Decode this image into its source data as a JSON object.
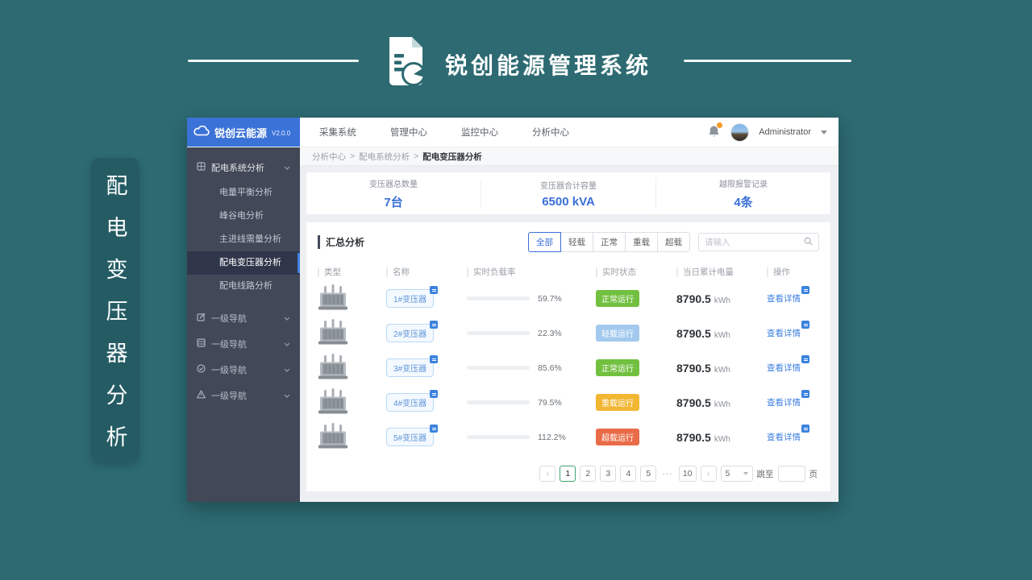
{
  "banner": {
    "title": "锐创能源管理系统"
  },
  "side_label": {
    "text": "配电变压器分析"
  },
  "dashboard": {
    "logo": {
      "name": "锐创云能源",
      "version": "V2.0.0"
    },
    "topnav": {
      "items": [
        "采集系统",
        "管理中心",
        "监控中心",
        "分析中心"
      ]
    },
    "user": {
      "name": "Administrator"
    },
    "sidebar": {
      "group_label": "配电系统分析",
      "children": [
        "电量平衡分析",
        "峰谷电分析",
        "主进线需量分析",
        "配电变压器分析",
        "配电线路分析"
      ],
      "extras": [
        "一级导航",
        "一级导航",
        "一级导航",
        "一级导航"
      ]
    },
    "breadcrumb": {
      "items": [
        "分析中心",
        "配电系统分析",
        "配电变压器分析"
      ],
      "separator": ">"
    },
    "stats": [
      {
        "label": "变压器总数量",
        "value": "7台"
      },
      {
        "label": "变压器合计容量",
        "value": "6500 kVA"
      },
      {
        "label": "越限报警记录",
        "value": "4条"
      }
    ],
    "summary": {
      "title": "汇总分析",
      "filters": [
        "全部",
        "轻载",
        "正常",
        "重载",
        "超载"
      ],
      "active_filter": "全部",
      "search_placeholder": "请输入",
      "table": {
        "headers": [
          "类型",
          "名称",
          "实时负载率",
          "实时状态",
          "当日累计电量",
          "操作"
        ],
        "rows": [
          {
            "name": "1#变压器",
            "load": "59.7%",
            "status": "正常运行",
            "status_color": "#72c040",
            "energy": "8790.5",
            "unit": "kWh",
            "action": "查看详情"
          },
          {
            "name": "2#变压器",
            "load": "22.3%",
            "status": "轻载运行",
            "status_color": "#a3c9ee",
            "energy": "8790.5",
            "unit": "kWh",
            "action": "查看详情"
          },
          {
            "name": "3#变压器",
            "load": "85.6%",
            "status": "正常运行",
            "status_color": "#72c040",
            "energy": "8790.5",
            "unit": "kWh",
            "action": "查看详情"
          },
          {
            "name": "4#变压器",
            "load": "79.5%",
            "status": "重载运行",
            "status_color": "#f2b632",
            "energy": "8790.5",
            "unit": "kWh",
            "action": "查看详情"
          },
          {
            "name": "5#变压器",
            "load": "112.2%",
            "status": "超载运行",
            "status_color": "#e96b47",
            "energy": "8790.5",
            "unit": "kWh",
            "action": "查看详情"
          }
        ]
      },
      "pagination": {
        "prev": "‹",
        "next": "›",
        "pages": [
          "1",
          "2",
          "3",
          "4",
          "5"
        ],
        "ellipsis": "···",
        "last_page": "10",
        "active_page": "1",
        "page_size": "5",
        "jump_label": "跳至",
        "page_label": "页"
      }
    }
  }
}
